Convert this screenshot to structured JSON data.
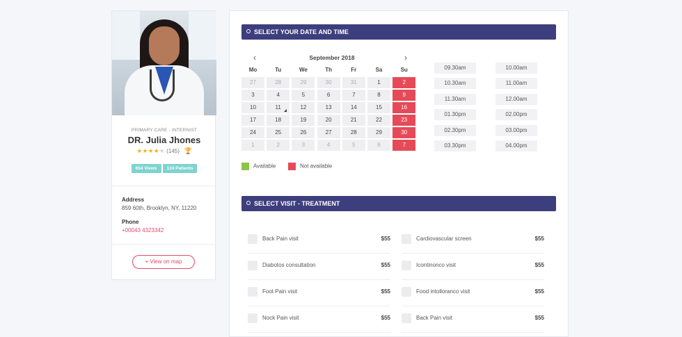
{
  "profile": {
    "specialty": "PRIMARY CARE - INTERNIST",
    "name": "DR. Julia Jhones",
    "rating_stars": 4,
    "rating_max": 5,
    "rating_count": "(145)",
    "views": "654 Views",
    "patients": "124 Patients",
    "address_label": "Address",
    "address": "859 60th, Brooklyn, NY, 11220",
    "phone_label": "Phone",
    "phone": "+00043 4323342",
    "map_button": "View on map"
  },
  "booking": {
    "date_header": "SELECT YOUR DATE AND TIME",
    "calendar": {
      "month": "September 2018",
      "weekdays": [
        "Mo",
        "Tu",
        "We",
        "Th",
        "Fr",
        "Sa",
        "Su"
      ],
      "weeks": [
        [
          {
            "d": "27",
            "muted": true
          },
          {
            "d": "28",
            "muted": true
          },
          {
            "d": "29",
            "muted": true
          },
          {
            "d": "30",
            "muted": true
          },
          {
            "d": "31",
            "muted": true
          },
          {
            "d": "1"
          },
          {
            "d": "2",
            "na": true
          }
        ],
        [
          {
            "d": "3"
          },
          {
            "d": "4"
          },
          {
            "d": "5"
          },
          {
            "d": "6"
          },
          {
            "d": "7"
          },
          {
            "d": "8"
          },
          {
            "d": "9",
            "na": true
          }
        ],
        [
          {
            "d": "10"
          },
          {
            "d": "11",
            "selected": true
          },
          {
            "d": "12"
          },
          {
            "d": "13"
          },
          {
            "d": "14"
          },
          {
            "d": "15"
          },
          {
            "d": "16",
            "na": true
          }
        ],
        [
          {
            "d": "17"
          },
          {
            "d": "18"
          },
          {
            "d": "19"
          },
          {
            "d": "20"
          },
          {
            "d": "21"
          },
          {
            "d": "22"
          },
          {
            "d": "23",
            "na": true
          }
        ],
        [
          {
            "d": "24"
          },
          {
            "d": "25"
          },
          {
            "d": "26"
          },
          {
            "d": "27"
          },
          {
            "d": "28"
          },
          {
            "d": "29"
          },
          {
            "d": "30",
            "na": true
          }
        ],
        [
          {
            "d": "1",
            "muted": true
          },
          {
            "d": "2",
            "muted": true
          },
          {
            "d": "3",
            "muted": true
          },
          {
            "d": "4",
            "muted": true
          },
          {
            "d": "5",
            "muted": true
          },
          {
            "d": "6",
            "muted": true
          },
          {
            "d": "7",
            "na": true
          }
        ]
      ]
    },
    "times_col1": [
      "09.30am",
      "10.30am",
      "11.30am",
      "01.30pm",
      "02.30pm",
      "03.30pm"
    ],
    "times_col2": [
      "10.00am",
      "11.00am",
      "12.00am",
      "02.00pm",
      "03.00pm",
      "04.00pm"
    ],
    "legend": {
      "available": "Available",
      "not_available": "Not available",
      "available_color": "#8cc34a",
      "not_available_color": "#e64a59"
    },
    "visit_header": "SELECT VISIT - TREATMENT",
    "treatments": [
      {
        "name": "Back Pain visit",
        "price": "$55"
      },
      {
        "name": "Cardiovascular screen",
        "price": "$55"
      },
      {
        "name": "Diabotos consultation",
        "price": "$55"
      },
      {
        "name": "Icontinonco visit",
        "price": "$55"
      },
      {
        "name": "Foot Pain visit",
        "price": "$55"
      },
      {
        "name": "Food intolloranco visit",
        "price": "$55"
      },
      {
        "name": "Nock Pain visit",
        "price": "$55"
      },
      {
        "name": "Back Pain visit",
        "price": "$55"
      }
    ]
  },
  "colors": {
    "header_bg": "#3d3e7d",
    "accent_pink": "#e0496a",
    "badge_teal": "#7ed3cf",
    "star": "#f5b21d"
  }
}
